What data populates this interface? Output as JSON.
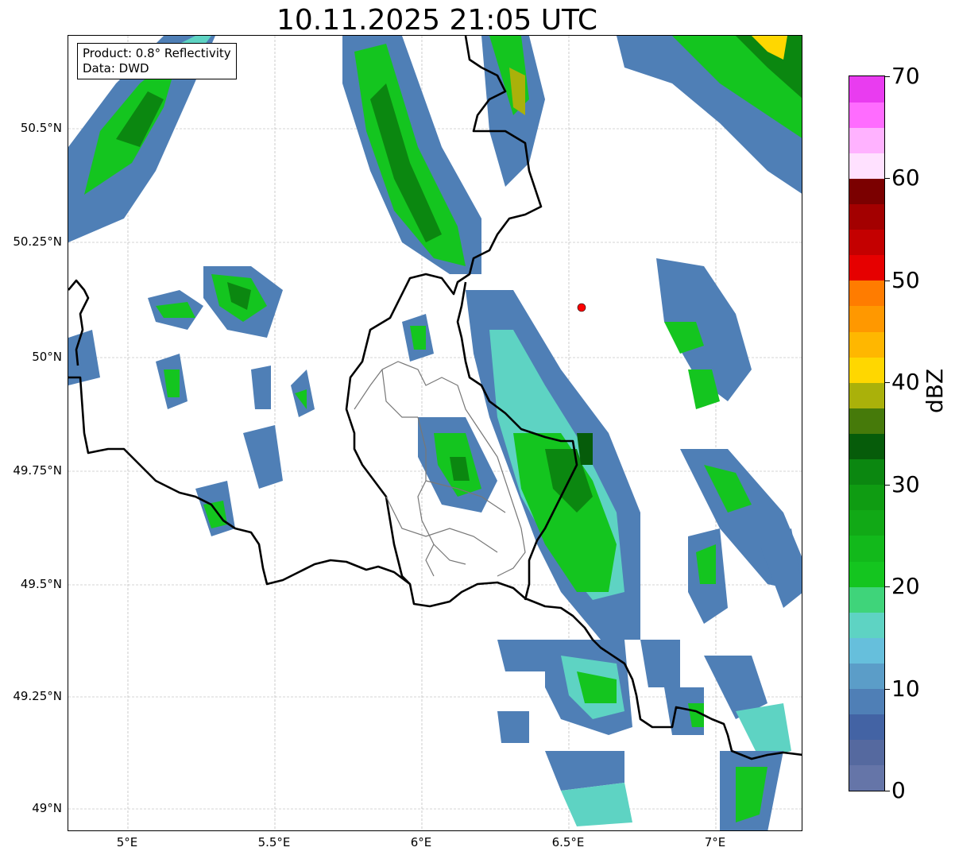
{
  "title": "10.11.2025 21:05 UTC",
  "info": {
    "line1": "Product: 0.8° Reflectivity",
    "line2": "Data: DWD"
  },
  "lat_labels": [
    "50.5°N",
    "50.25°N",
    "50°N",
    "49.75°N",
    "49.5°N",
    "49.25°N",
    "49°N"
  ],
  "lon_labels": [
    "5°E",
    "5.5°E",
    "6°E",
    "6.5°E",
    "7°E"
  ],
  "colorbar": {
    "unit": "dBZ",
    "tick_labels": [
      "0",
      "10",
      "20",
      "30",
      "40",
      "50",
      "60",
      "70"
    ],
    "colors": [
      "#6575a8",
      "#55699f",
      "#4363a4",
      "#4f7fb6",
      "#5b9dc8",
      "#66bfdc",
      "#5ed3c3",
      "#3fd47a",
      "#14c51f",
      "#12b91b",
      "#11a916",
      "#0f9c12",
      "#0b8710",
      "#065c0a",
      "#467a0a",
      "#aab10a",
      "#ffd700",
      "#ffb700",
      "#ff9800",
      "#ff7c00",
      "#e60000",
      "#c40000",
      "#a30000",
      "#7b0000",
      "#ffe1ff",
      "#ffb2ff",
      "#ff6cff",
      "#e93cf0"
    ]
  },
  "radar_site": {
    "color": "#ff0000"
  }
}
